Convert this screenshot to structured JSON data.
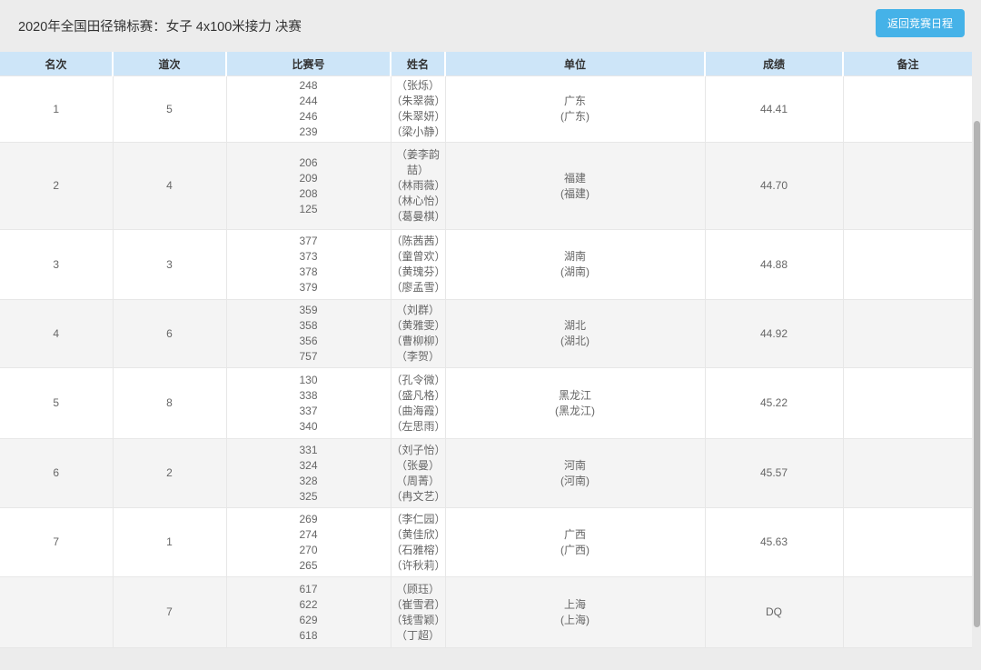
{
  "page": {
    "title": "2020年全国田径锦标赛：女子 4x100米接力 决赛",
    "back_button": "返回竞赛日程",
    "accent_color": "#45b2e8",
    "header_bg_color": "#cde5f8"
  },
  "table": {
    "headers": [
      "名次",
      "道次",
      "比赛号",
      "姓名",
      "单位",
      "成绩",
      "备注"
    ],
    "rows": [
      {
        "rank": "1",
        "lane": "5",
        "bibs": [
          "248",
          "244",
          "246",
          "239"
        ],
        "names": [
          "（张烁）",
          "（朱翠薇）",
          "（朱翠妍）",
          "（梁小静）"
        ],
        "unit": "广东",
        "unit_sub": "(广东)",
        "result": "44.41",
        "remark": ""
      },
      {
        "rank": "2",
        "lane": "4",
        "bibs": [
          "206",
          "209",
          "208",
          "125"
        ],
        "names": [
          "（姜李韵喆）",
          "（林雨薇）",
          "（林心怡）",
          "（葛曼棋）"
        ],
        "unit": "福建",
        "unit_sub": "(福建)",
        "result": "44.70",
        "remark": ""
      },
      {
        "rank": "3",
        "lane": "3",
        "bibs": [
          "377",
          "373",
          "378",
          "379"
        ],
        "names": [
          "（陈茜茜）",
          "（童曾欢）",
          "（黄瑰芬）",
          "（廖孟雪）"
        ],
        "unit": "湖南",
        "unit_sub": "(湖南)",
        "result": "44.88",
        "remark": ""
      },
      {
        "rank": "4",
        "lane": "6",
        "bibs": [
          "359",
          "358",
          "356",
          "757"
        ],
        "names": [
          "（刘群）",
          "（黄雅雯）",
          "（曹柳柳）",
          "（李贺）"
        ],
        "unit": "湖北",
        "unit_sub": "(湖北)",
        "result": "44.92",
        "remark": ""
      },
      {
        "rank": "5",
        "lane": "8",
        "bibs": [
          "130",
          "338",
          "337",
          "340"
        ],
        "names": [
          "（孔令微）",
          "（盛凡格）",
          "（曲海霞）",
          "（左思雨）"
        ],
        "unit": "黑龙江",
        "unit_sub": "(黑龙江)",
        "result": "45.22",
        "remark": ""
      },
      {
        "rank": "6",
        "lane": "2",
        "bibs": [
          "331",
          "324",
          "328",
          "325"
        ],
        "names": [
          "（刘子怡）",
          "（张曼）",
          "（周菁）",
          "（冉文艺）"
        ],
        "unit": "河南",
        "unit_sub": "(河南)",
        "result": "45.57",
        "remark": ""
      },
      {
        "rank": "7",
        "lane": "1",
        "bibs": [
          "269",
          "274",
          "270",
          "265"
        ],
        "names": [
          "（李仁园）",
          "（黄佳欣）",
          "（石雅榕）",
          "（许秋莉）"
        ],
        "unit": "广西",
        "unit_sub": "(广西)",
        "result": "45.63",
        "remark": ""
      },
      {
        "rank": "",
        "lane": "7",
        "bibs": [
          "617",
          "622",
          "629",
          "618"
        ],
        "names": [
          "（顾珏）",
          "（崔雪君）",
          "（钱雪颖）",
          "（丁超）"
        ],
        "unit": "上海",
        "unit_sub": "(上海)",
        "result": "DQ",
        "remark": ""
      }
    ]
  }
}
